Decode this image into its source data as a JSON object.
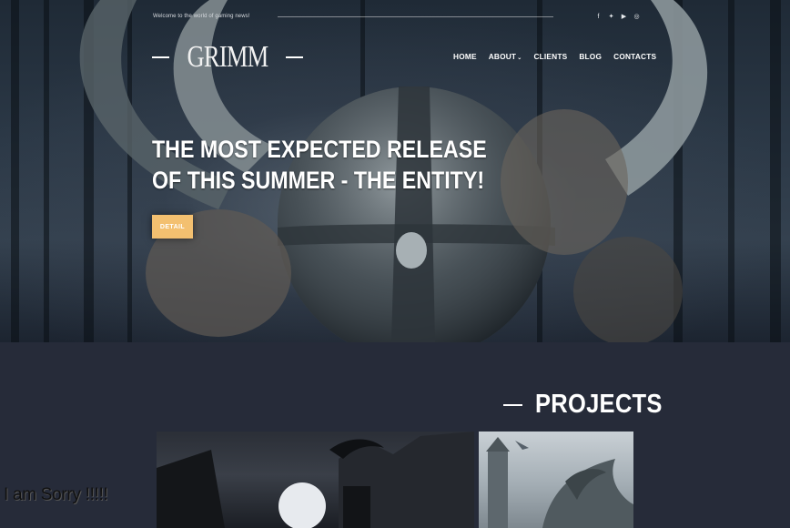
{
  "header": {
    "tagline": "Welcome to the world of gaming news!",
    "social_icons": [
      {
        "name": "facebook-icon",
        "glyph": "f"
      },
      {
        "name": "twitter-icon",
        "glyph": "✦"
      },
      {
        "name": "youtube-icon",
        "glyph": "▶"
      },
      {
        "name": "instagram-icon",
        "glyph": "◎"
      }
    ],
    "logo_text": "GRIMM",
    "nav": [
      {
        "label": "HOME"
      },
      {
        "label": "ABOUT",
        "has_dropdown": true
      },
      {
        "label": "CLIENTS"
      },
      {
        "label": "BLOG"
      },
      {
        "label": "CONTACTS"
      }
    ]
  },
  "hero": {
    "headline_line1": "THE MOST EXPECTED RELEASE",
    "headline_line2": "OF THIS SUMMER - THE ENTITY!",
    "button_label": "DETAIL"
  },
  "projects": {
    "title": "PROJECTS"
  },
  "overlay_text": "I am Sorry !!!!!",
  "colors": {
    "page_bg": "#262b39",
    "accent_button": "#f3c070",
    "text": "#ffffff"
  }
}
